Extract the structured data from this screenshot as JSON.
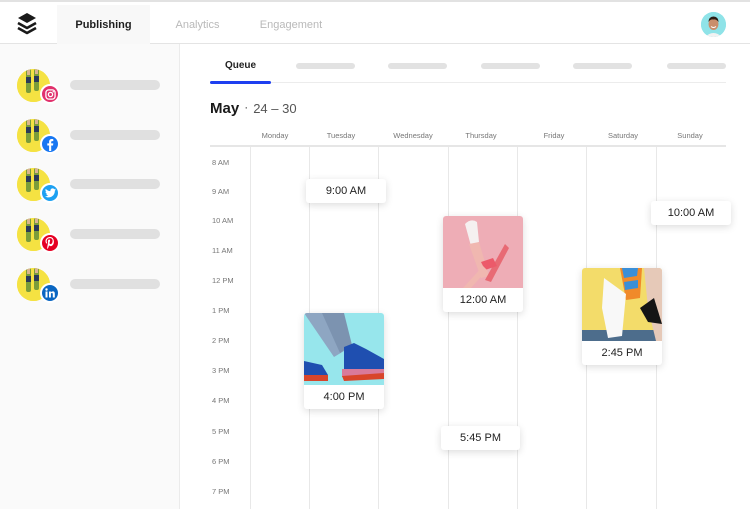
{
  "topbar": {
    "logo": "buffer-stack-icon",
    "tabs": [
      {
        "label": "Publishing",
        "active": true
      },
      {
        "label": "Analytics",
        "active": false
      },
      {
        "label": "Engagement",
        "active": false
      }
    ],
    "avatar": "user-avatar"
  },
  "sidebar": {
    "accounts": [
      {
        "network": "instagram",
        "color": "#e1306c"
      },
      {
        "network": "facebook",
        "color": "#1877f2"
      },
      {
        "network": "twitter",
        "color": "#1da1f2"
      },
      {
        "network": "pinterest",
        "color": "#e60023"
      },
      {
        "network": "linkedin",
        "color": "#0a66c2"
      }
    ]
  },
  "main": {
    "tabs": [
      {
        "label": "Queue",
        "active": true
      },
      {
        "label": ""
      },
      {
        "label": ""
      },
      {
        "label": ""
      },
      {
        "label": ""
      },
      {
        "label": ""
      }
    ],
    "accent_color": "#1e3ff0",
    "date": {
      "month": "May",
      "separator": "·",
      "range": "24 – 30"
    },
    "days": [
      "Monday",
      "Tuesday",
      "Wednesday",
      "Thursday",
      "Friday",
      "Saturday",
      "Sunday"
    ],
    "hours": [
      "8 AM",
      "9 AM",
      "10 AM",
      "11 AM",
      "12 PM",
      "1 PM",
      "2 PM",
      "3 PM",
      "4 PM",
      "5 PM",
      "6 PM",
      "7 PM"
    ],
    "posts": [
      {
        "day": "Tuesday",
        "time": "9:00 AM",
        "image": null
      },
      {
        "day": "Tuesday",
        "time": "4:00 PM",
        "image": "blue-sneakers-cyan-background"
      },
      {
        "day": "Thursday",
        "time": "12:00 AM",
        "image": "legs-white-sneakers-pink-background"
      },
      {
        "day": "Thursday",
        "time": "5:45 PM",
        "image": null
      },
      {
        "day": "Saturday",
        "time": "2:45 PM",
        "image": "white-sneaker-patterned-sock-yellow-background"
      },
      {
        "day": "Sunday",
        "time": "10:00 AM",
        "image": null
      }
    ]
  }
}
